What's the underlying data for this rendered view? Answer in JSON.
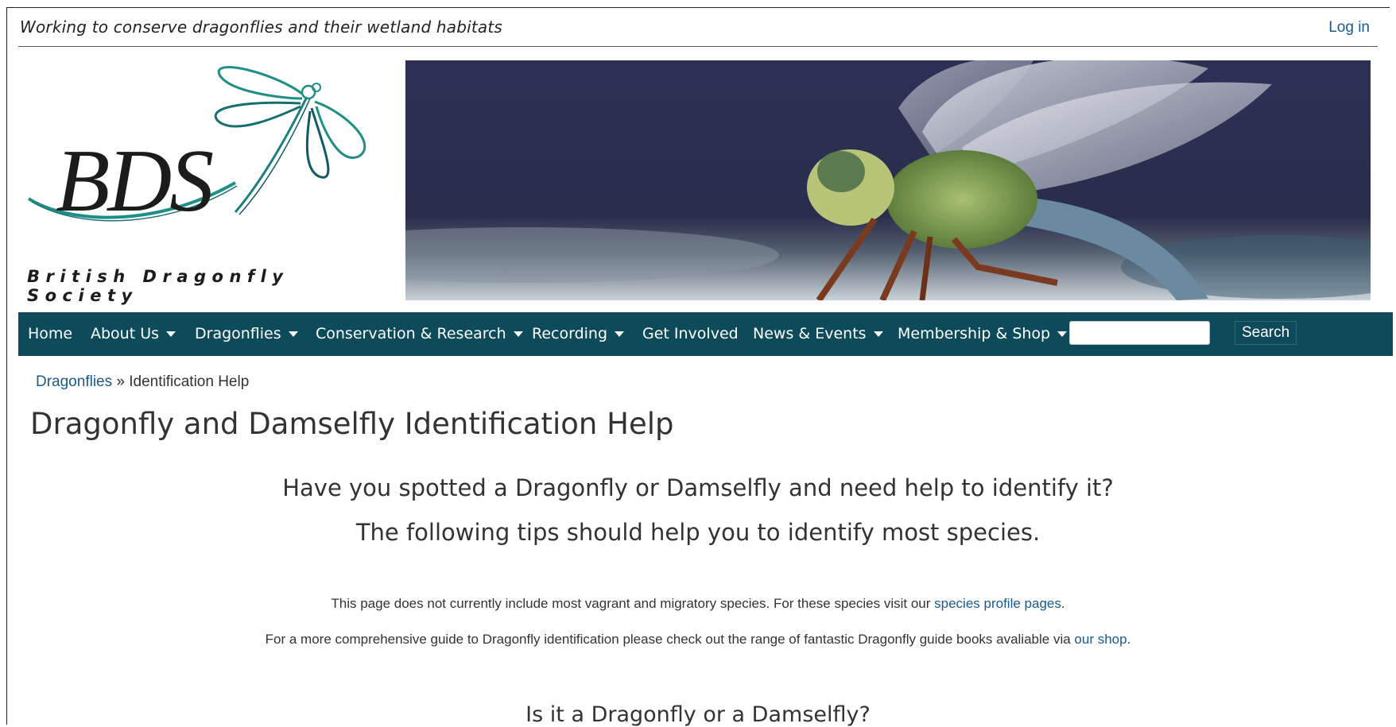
{
  "header": {
    "tagline": "Working to conserve dragonflies and their wetland habitats",
    "login_label": "Log in"
  },
  "logo": {
    "letters": "BDS",
    "society_name": "British Dragonfly Society"
  },
  "nav": {
    "items": [
      {
        "label": "Home",
        "dropdown": false
      },
      {
        "label": "About Us",
        "dropdown": true
      },
      {
        "label": "Dragonflies",
        "dropdown": true
      },
      {
        "label": "Conservation & Research",
        "dropdown": true
      },
      {
        "label": "Recording",
        "dropdown": true
      },
      {
        "label": "Get Involved",
        "dropdown": false
      },
      {
        "label": "News & Events",
        "dropdown": true
      },
      {
        "label": "Membership & Shop",
        "dropdown": true
      }
    ],
    "search_value": "",
    "search_button": "Search"
  },
  "breadcrumb": {
    "parent": "Dragonflies",
    "separator": "»",
    "current": "Identification Help"
  },
  "main": {
    "title": "Dragonfly and Damselfly Identification Help",
    "subtitle1": "Have you spotted a Dragonfly or Damselfly and need help to identify it?",
    "subtitle2": "The following tips should help you to identify most species.",
    "para1_text": "This page does not currently include most vagrant and migratory species. For these species visit our ",
    "para1_link": "species profile pages",
    "para1_end": ".",
    "para2_text": "For a more comprehensive guide to Dragonfly identification please check out the range of fantastic Dragonfly guide books avaliable via ",
    "para2_link": "our shop",
    "para2_end": ".",
    "section_heading": "Is it a Dragonfly or a Damselfly?"
  },
  "colors": {
    "nav_bg": "#0d4a5a",
    "link": "#1a5a8a",
    "logo_teal": "#1f8f85"
  }
}
